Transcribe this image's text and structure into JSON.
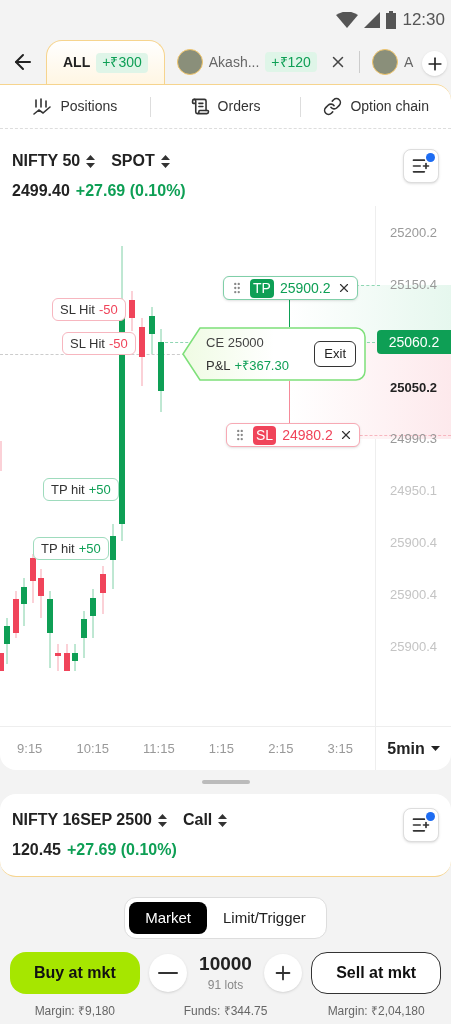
{
  "status_bar": {
    "time": "12:30"
  },
  "tabs": [
    {
      "kind": "all",
      "label": "ALL",
      "pnl": "+₹300",
      "selected": true,
      "closable": false
    },
    {
      "kind": "user",
      "label": "Akash...",
      "pnl": "+₹120",
      "selected": false,
      "closable": true
    },
    {
      "kind": "user",
      "label": "A",
      "selected": false,
      "closable": false
    }
  ],
  "nav": [
    {
      "kind": "positions",
      "label": "Positions"
    },
    {
      "kind": "orders",
      "label": "Orders"
    },
    {
      "kind": "chain",
      "label": "Option chain"
    }
  ],
  "instrument": {
    "name": "NIFTY 50",
    "type": "SPOT",
    "price": "2499.40",
    "change": "+27.69 (0.10%)",
    "notification": true
  },
  "chart": {
    "y_labels": [
      {
        "text": "25200.2",
        "kind": "tick"
      },
      {
        "text": "25150.4",
        "kind": "tick"
      },
      {
        "text": "25060.2",
        "kind": "current"
      },
      {
        "text": "25050.2",
        "kind": "strong"
      },
      {
        "text": "24990.3",
        "kind": "tick"
      },
      {
        "text": "24950.1",
        "kind": "faint"
      },
      {
        "text": "25900.4",
        "kind": "faint"
      },
      {
        "text": "25900.4",
        "kind": "faint"
      },
      {
        "text": "25900.4",
        "kind": "faint"
      }
    ],
    "x_labels": [
      "9:15",
      "10:15",
      "11:15",
      "1:15",
      "2:15",
      "3:15"
    ],
    "interval": "5min",
    "trade_markers": [
      {
        "kind": "sl",
        "label": "SL Hit",
        "value": "-50"
      },
      {
        "kind": "sl",
        "label": "SL Hit",
        "value": "-50"
      },
      {
        "kind": "tp",
        "label": "TP hit",
        "value": "+50"
      },
      {
        "kind": "tp",
        "label": "TP hit",
        "value": "+50"
      }
    ],
    "tp_order": {
      "tag": "TP",
      "price": "25900.2"
    },
    "sl_order": {
      "tag": "SL",
      "price": "24980.2"
    },
    "position": {
      "contract": "CE 25000",
      "pnl_label": "P&L",
      "pnl": "+₹367.30",
      "action": "Exit"
    }
  },
  "order_instrument": {
    "name": "NIFTY 16SEP 2500",
    "type": "Call",
    "price": "120.45",
    "change": "+27.69 (0.10%)",
    "notification": true
  },
  "order_types": [
    {
      "label": "Market",
      "selected": true
    },
    {
      "label": "Limit/Trigger",
      "selected": false
    }
  ],
  "buy": {
    "label": "Buy at mkt",
    "note": "Margin: ₹9,180"
  },
  "quantity": {
    "value": "10000",
    "lots": "91 lots",
    "note": "Funds: ₹344.75"
  },
  "sell": {
    "label": "Sell at mkt",
    "note": "Margin: ₹2,04,180"
  }
}
